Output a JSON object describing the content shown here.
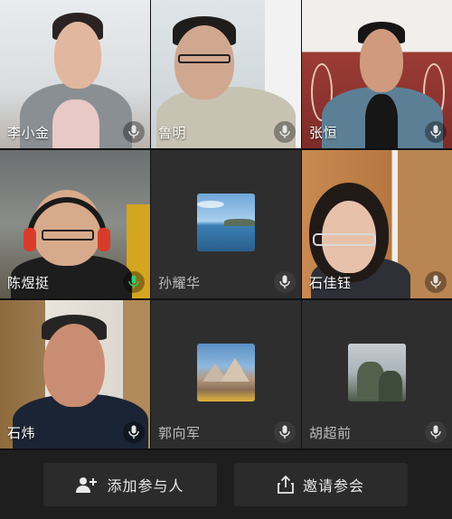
{
  "participants": [
    {
      "name": "李小金",
      "mic": "mic-icon"
    },
    {
      "name": "鲁明",
      "mic": "mic-icon"
    },
    {
      "name": "张恒",
      "mic": "mic-icon"
    },
    {
      "name": "陈煜挺",
      "mic": "mic-active-icon"
    },
    {
      "name": "孙耀华",
      "mic": "mic-icon"
    },
    {
      "name": "石佳钰",
      "mic": "mic-icon"
    },
    {
      "name": "石炜",
      "mic": "mic-icon"
    },
    {
      "name": "郭向军",
      "mic": "mic-icon"
    },
    {
      "name": "胡超前",
      "mic": "mic-icon"
    }
  ],
  "toolbar": {
    "add_participant_label": "添加参与人",
    "invite_label": "邀请参会"
  },
  "colors": {
    "background": "#1e1e1e",
    "button_bg": "#2b2b2b",
    "mic_active": "#2ecc71"
  }
}
